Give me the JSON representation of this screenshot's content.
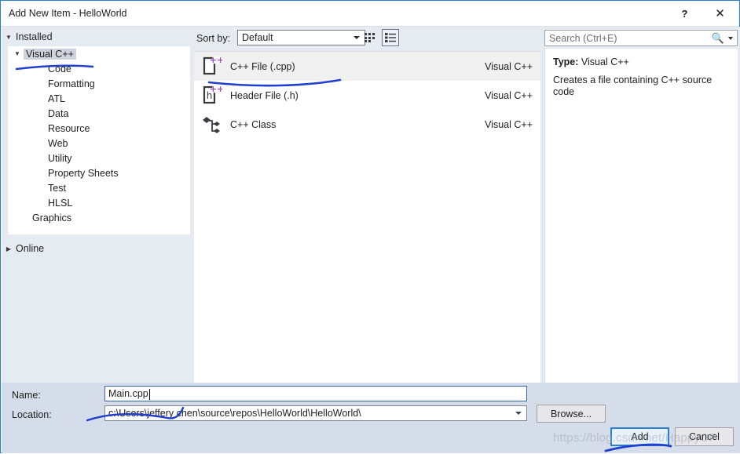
{
  "window": {
    "title": "Add New Item - HelloWorld",
    "help_label": "?",
    "close_label": "✕"
  },
  "sidebar": {
    "installed_group": "Installed",
    "online_group": "Online",
    "items": [
      {
        "label": "Visual C++",
        "level": 0,
        "selected": true,
        "expanded": true
      },
      {
        "label": "Code",
        "level": 1,
        "selected": false
      },
      {
        "label": "Formatting",
        "level": 1,
        "selected": false
      },
      {
        "label": "ATL",
        "level": 1,
        "selected": false
      },
      {
        "label": "Data",
        "level": 1,
        "selected": false
      },
      {
        "label": "Resource",
        "level": 1,
        "selected": false
      },
      {
        "label": "Web",
        "level": 1,
        "selected": false
      },
      {
        "label": "Utility",
        "level": 1,
        "selected": false
      },
      {
        "label": "Property Sheets",
        "level": 1,
        "selected": false
      },
      {
        "label": "Test",
        "level": 1,
        "selected": false
      },
      {
        "label": "HLSL",
        "level": 1,
        "selected": false
      },
      {
        "label": "Graphics",
        "level": 0,
        "selected": false
      }
    ]
  },
  "toolbar": {
    "sort_label": "Sort by:",
    "sort_value": "Default",
    "sort_options": [
      "Default"
    ],
    "grid_view_title": "Medium Icons",
    "list_view_title": "Small Icons"
  },
  "templates": [
    {
      "name": "C++ File (.cpp)",
      "origin": "Visual C++",
      "icon": "cpp-file-icon",
      "selected": true
    },
    {
      "name": "Header File (.h)",
      "origin": "Visual C++",
      "icon": "header-file-icon",
      "selected": false
    },
    {
      "name": "C++ Class",
      "origin": "Visual C++",
      "icon": "cpp-class-icon",
      "selected": false
    }
  ],
  "search": {
    "placeholder": "Search (Ctrl+E)",
    "value": ""
  },
  "details": {
    "type_label": "Type:",
    "type_value": "Visual C++",
    "description": "Creates a file containing C++ source code"
  },
  "footer": {
    "name_label": "Name:",
    "name_value": "Main.cpp",
    "location_label": "Location:",
    "location_value": "c:\\Users\\jeffery chen\\source\\repos\\HelloWorld\\HelloWorld\\",
    "browse_label": "Browse...",
    "add_label": "Add",
    "cancel_label": "Cancel"
  },
  "watermark": {
    "text": "https://blog.csdn.net/HappyCF"
  },
  "colors": {
    "dialog_border": "#2a7fd4",
    "panel_bg": "#e6ebf2",
    "footer_bg": "#d5dcea",
    "selection": "#f0f0f0",
    "tree_selection": "#cfd3dc",
    "annotation_blue": "#1f4fd8",
    "icon_accent": "#9b4fc4"
  }
}
